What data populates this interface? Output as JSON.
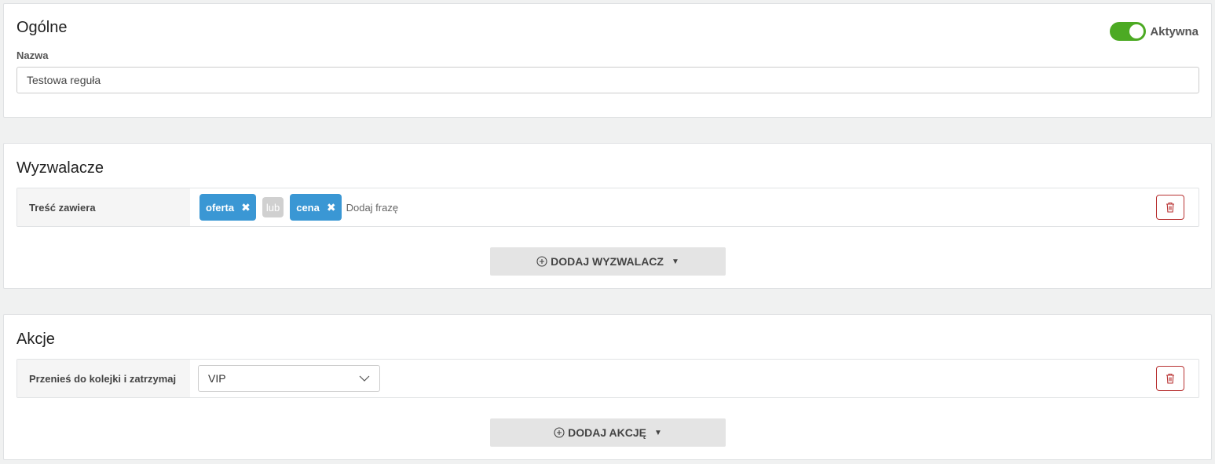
{
  "general": {
    "title": "Ogólne",
    "active_label": "Aktywna",
    "name_label": "Nazwa",
    "name_value": "Testowa reguła"
  },
  "triggers": {
    "title": "Wyzwalacze",
    "row_label": "Treść zawiera",
    "chips": [
      "oferta",
      "cena"
    ],
    "separator": "lub",
    "phrase_placeholder": "Dodaj frazę",
    "add_button": "DODAJ WYZWALACZ"
  },
  "actions": {
    "title": "Akcje",
    "row_label": "Przenieś do kolejki i zatrzymaj",
    "selected_queue": "VIP",
    "add_button": "DODAJ AKCJĘ"
  },
  "colors": {
    "chip": "#3a97d4",
    "toggle_on": "#4caa23",
    "danger": "#b83232"
  }
}
